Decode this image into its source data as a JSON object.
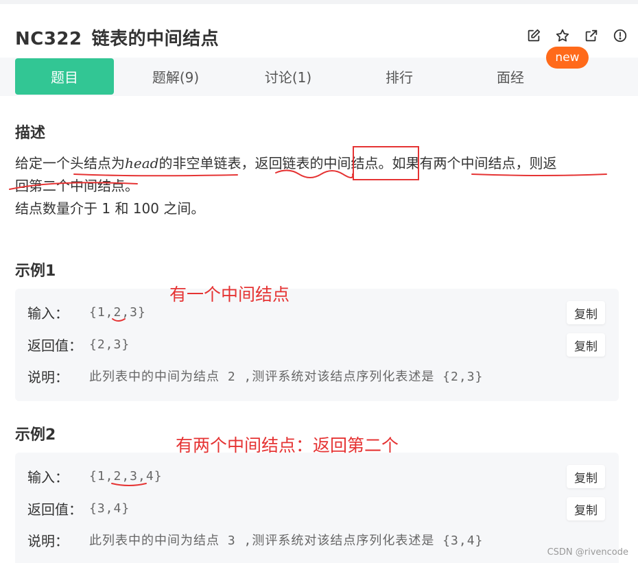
{
  "problem": {
    "code": "NC322",
    "title": "链表的中间结点"
  },
  "header_icons": [
    "edit-icon",
    "star-icon",
    "share-icon",
    "report-icon"
  ],
  "tabs": [
    {
      "label": "题目",
      "active": true
    },
    {
      "label": "题解(9)",
      "active": false
    },
    {
      "label": "讨论(1)",
      "active": false
    },
    {
      "label": "排行",
      "active": false
    },
    {
      "label": "面经",
      "active": false
    }
  ],
  "badge": {
    "label": "new"
  },
  "description": {
    "heading": "描述",
    "line1_a": "给定一个头结点为",
    "line1_var": "head",
    "line1_b": "的非空单链表，返回链表的中间结点。如果有两个中间结点，则返",
    "line2": "回第二个中间结点。",
    "line3": "结点数量介于 1 和 100 之间。"
  },
  "examples": [
    {
      "heading": "示例1",
      "input_label": "输入：",
      "input": "{1,2,3}",
      "output_label": "返回值：",
      "output": "{2,3}",
      "note_label": "说明：",
      "note": "此列表中的中间为结点 2 ,测评系统对该结点序列化表述是 {2,3}",
      "copy_label": "复制"
    },
    {
      "heading": "示例2",
      "input_label": "输入：",
      "input": "{1,2,3,4}",
      "output_label": "返回值：",
      "output": "{3,4}",
      "note_label": "说明：",
      "note": "此列表中的中间为结点 3 ,测评系统对该结点序列化表述是 {3,4}",
      "copy_label": "复制"
    }
  ],
  "annotations": {
    "example1": "有一个中间结点",
    "example2": "有两个中间结点：返回第二个"
  },
  "watermark": "CSDN @rivencode",
  "colors": {
    "accent": "#32c694",
    "badge": "#ff6a1a",
    "annotation": "#e53333"
  }
}
